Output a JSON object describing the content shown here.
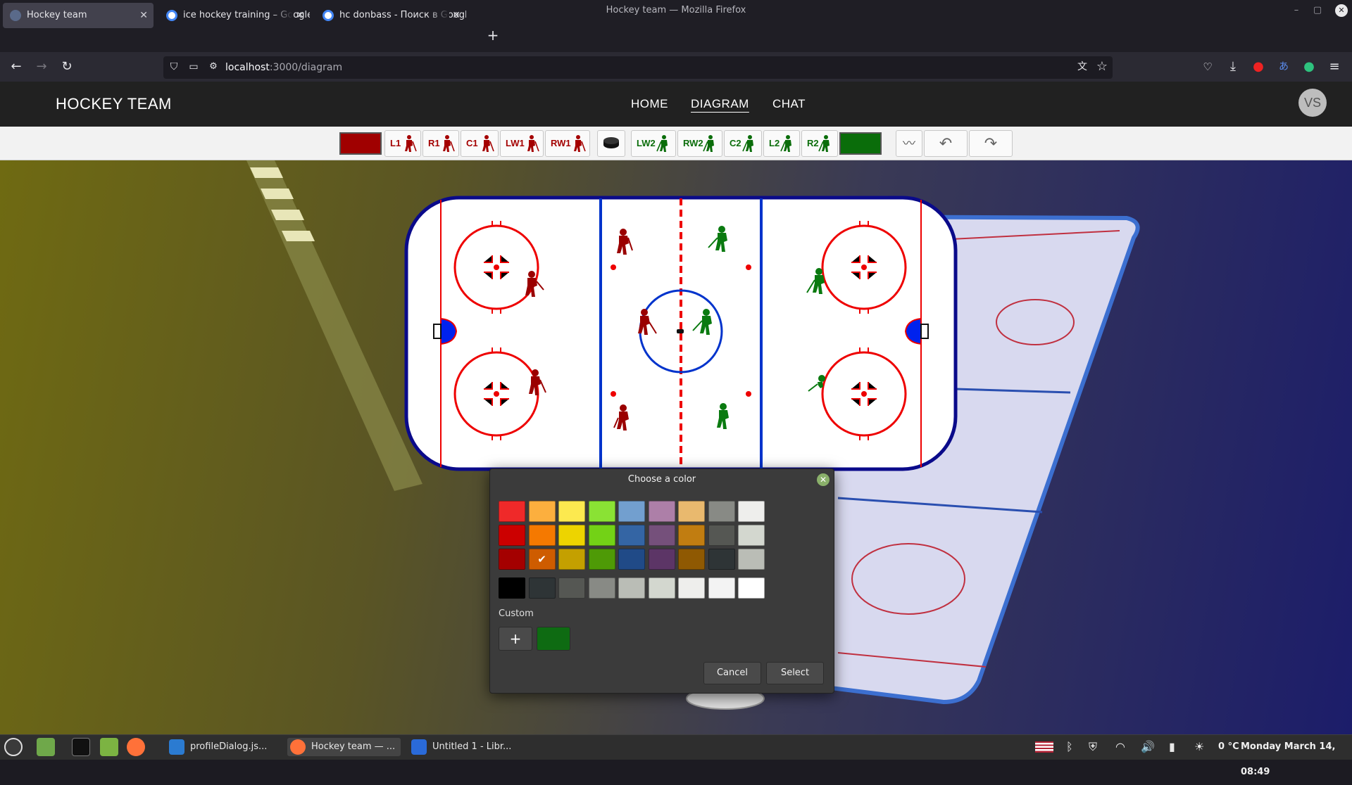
{
  "window": {
    "title": "Hockey team — Mozilla Firefox"
  },
  "tabs": [
    {
      "label": "Hockey team",
      "active": true
    },
    {
      "label": "ice hockey training – Google"
    },
    {
      "label": "hc donbass - Поиск в Google"
    }
  ],
  "url": {
    "host": "localhost",
    "rest": ":3000/diagram"
  },
  "app": {
    "brand": "HOCKEY TEAM",
    "nav": [
      "HOME",
      "DIAGRAM",
      "CHAT"
    ],
    "active_nav": "DIAGRAM",
    "avatar": "VS"
  },
  "toolbar": {
    "team_a_color": "#a00000",
    "team_b_color": "#0a6d0a",
    "team_a_buttons": [
      "L1",
      "R1",
      "C1",
      "LW1",
      "RW1"
    ],
    "team_b_buttons": [
      "LW2",
      "RW2",
      "C2",
      "L2",
      "R2"
    ]
  },
  "dialog": {
    "title": "Choose a color",
    "palette": [
      [
        "#ef2929",
        "#fcaf3e",
        "#fce94f",
        "#8ae234",
        "#729fcf",
        "#ad7fa8",
        "#e9b96e",
        "#888a85",
        "#eeeeec"
      ],
      [
        "#cc0000",
        "#f57900",
        "#edd400",
        "#73d216",
        "#3465a4",
        "#75507b",
        "#c17d11",
        "#555753",
        "#d3d7cf"
      ],
      [
        "#a40000",
        "#ce5c00",
        "#c4a000",
        "#4e9a06",
        "#204a87",
        "#5c3566",
        "#8f5902",
        "#2e3436",
        "#babdb6"
      ]
    ],
    "grays": [
      "#000000",
      "#2e3436",
      "#555753",
      "#888a85",
      "#babdb6",
      "#d3d7cf",
      "#eeeeec",
      "#f3f3f3",
      "#ffffff"
    ],
    "selected": "#ce5c00",
    "custom_label": "Custom",
    "custom_add": "+",
    "custom_colors": [
      "#0e6b12"
    ],
    "cancel": "Cancel",
    "select": "Select"
  },
  "taskbar": {
    "apps": [
      "profileDialog.js...",
      "Hockey team — ...",
      "Untitled 1 - Libr..."
    ],
    "temperature": "0 °C",
    "clock": "Monday March 14, 08:49"
  }
}
